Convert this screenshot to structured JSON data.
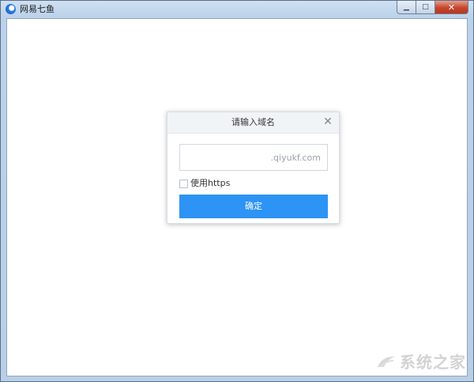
{
  "window": {
    "title": "网易七鱼",
    "minimize_glyph": "▁",
    "maximize_glyph": "□",
    "close_glyph": "✕"
  },
  "dialog": {
    "title": "请输入域名",
    "close_glyph": "✕",
    "domain_input": {
      "value": "",
      "suffix": ".qiyukf.com"
    },
    "https_checkbox": {
      "label": "使用https",
      "checked": false
    },
    "confirm_label": "确定"
  },
  "watermark": {
    "text": "系统之家"
  },
  "colors": {
    "primary_button": "#2d93f5",
    "dialog_header": "#f1f4f7"
  }
}
